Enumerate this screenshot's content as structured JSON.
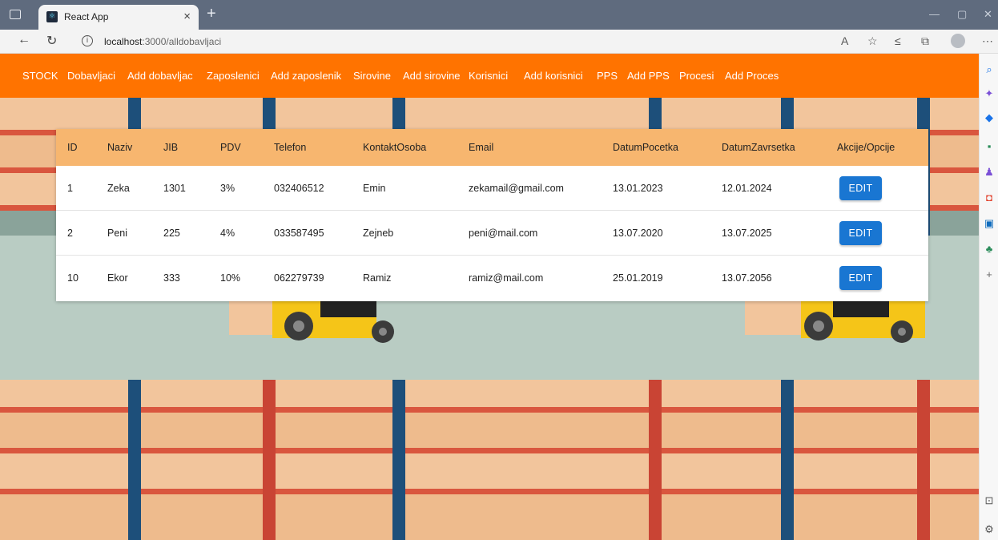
{
  "browser": {
    "tab_title": "React App",
    "tab_close": "×",
    "new_tab": "+",
    "url_host": "localhost",
    "url_path": ":3000/alldobavljaci"
  },
  "navbar": {
    "brand": "STOCK",
    "links": [
      "Dobavljaci",
      "Add dobavljac",
      "Zaposlenici",
      "Add zaposlenik",
      "Sirovine",
      "Add sirovine",
      "Korisnici",
      "Add korisnici",
      "PPS",
      "Add PPS",
      "Procesi",
      "Add Proces"
    ]
  },
  "table": {
    "headers": [
      "ID",
      "Naziv",
      "JIB",
      "PDV",
      "Telefon",
      "KontaktOsoba",
      "Email",
      "DatumPocetka",
      "DatumZavrsetka",
      "Akcije/Opcije"
    ],
    "rows": [
      [
        "1",
        "Zeka",
        "1301",
        "3%",
        "032406512",
        "Emin",
        "zekamail@gmail.com",
        "13.01.2023",
        "12.01.2024"
      ],
      [
        "2",
        "Peni",
        "225",
        "4%",
        "033587495",
        "Zejneb",
        "peni@mail.com",
        "13.07.2020",
        "13.07.2025"
      ],
      [
        "10",
        "Ekor",
        "333",
        "10%",
        "062279739",
        "Ramiz",
        "ramiz@mail.com",
        "25.01.2019",
        "13.07.2056"
      ]
    ],
    "edit_label": "EDIT"
  },
  "colors": {
    "navbar": "#ff7300",
    "table_header": "#f7b66f",
    "edit_button": "#1976d2"
  }
}
